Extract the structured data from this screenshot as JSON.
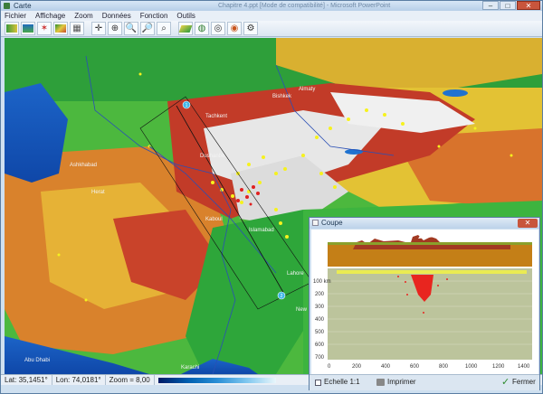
{
  "window": {
    "title": "Carte",
    "background_title": "Chapitre 4.ppt [Mode de compatibilité] - Microsoft PowerPoint",
    "controls": {
      "minimize": "–",
      "maximize": "□",
      "close": "✕"
    }
  },
  "menu": {
    "items": [
      "Fichier",
      "Affichage",
      "Zoom",
      "Données",
      "Fonction",
      "Outils"
    ]
  },
  "toolbar": {
    "icons": [
      "map-icon",
      "layers-icon",
      "earthquake-icon",
      "terrain-icon",
      "grid-icon",
      "pointer-icon",
      "crosshair-icon",
      "zoom-in-icon",
      "zoom-out-icon",
      "zoom-box-icon",
      "relief-icon",
      "globe-icon",
      "target-icon",
      "compass-icon",
      "settings-icon"
    ]
  },
  "map": {
    "labels": [
      "Almaty",
      "Bishkek",
      "Tachkent",
      "Dushanbe",
      "Ashkhabad",
      "Kaboul",
      "Islamabad",
      "Lahore",
      "Abu Dhabi",
      "Karachi",
      "New Delhi",
      "Herat"
    ],
    "profile_marker_labels": [
      "1",
      "2"
    ]
  },
  "status": {
    "lat": "Lat: 35,1451°",
    "lon": "Lon: 74,0181°",
    "zoom": "Zoom = 8,00"
  },
  "coupe": {
    "title": "Coupe",
    "close": "✕",
    "scale_checkbox_label": "Echelle 1:1",
    "print_label": "Imprimer",
    "close_label": "Fermer",
    "depth_ticks": [
      "100 km",
      "200",
      "300",
      "400",
      "500",
      "600",
      "700"
    ],
    "distance_ticks": [
      "0",
      "200",
      "400",
      "600",
      "800",
      "1000",
      "1200",
      "1400"
    ]
  }
}
